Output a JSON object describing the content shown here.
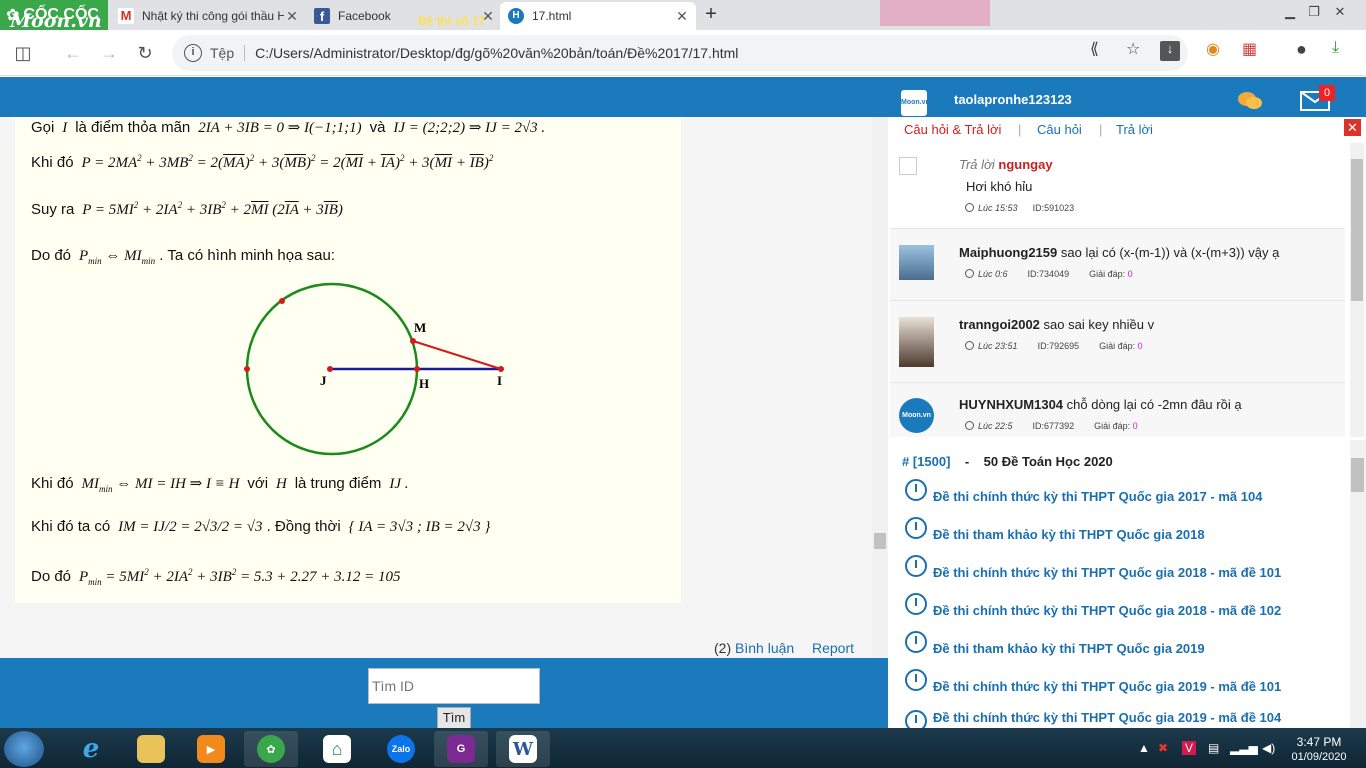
{
  "browser": {
    "brand": "CỐC CỐC",
    "tabs": [
      {
        "title": "Nhật ký thi công gói thầu Hồ",
        "active": false
      },
      {
        "title": "Facebook",
        "active": false
      },
      {
        "title": "17.html",
        "active": true
      }
    ],
    "new_tab": "+",
    "scheme_label": "Tệp",
    "url": "C:/Users/Administrator/Desktop/đg/gõ%20văn%20bản/toán/Đề%2017/17.html"
  },
  "site": {
    "logo": "Moon.vn",
    "exam_title": "Đề thi số 17"
  },
  "solution": {
    "l1_a": "Gọi",
    "l1_b": "là điểm thỏa mãn",
    "l1_c": "và",
    "l2_a": "Khi đó",
    "l3_a": "Suy ra",
    "l4_a": "Do đó",
    "l4_b": ". Ta có hình minh họa sau:",
    "fig_label_m": "M",
    "fig_label_j": "J",
    "fig_label_h": "H",
    "fig_label_i": "I",
    "l5_a": "Khi đó",
    "l5_b": "với",
    "l5_c": "là trung điểm",
    "l6_a": "Khi đó ta có",
    "l6_b": ". Đồng thời",
    "l7_a": "Do đó"
  },
  "comments": {
    "count": "(2)",
    "link": "Bình luận",
    "report": "Report"
  },
  "footer": {
    "search_placeholder": "Tìm ID",
    "search_button": "Tìm"
  },
  "panel": {
    "username": "taolapronhe123123",
    "mail_badge": "0",
    "tabs": [
      "Câu hỏi & Trả lời",
      "Câu hỏi",
      "Trả lời"
    ],
    "qa": [
      {
        "prefix": "Trả lời",
        "name": "ngungay",
        "text": "Hơi khó hỉu",
        "time": "Lúc 15:53",
        "id": "ID:591023",
        "answers": ""
      },
      {
        "prefix": "",
        "name": "Maiphuong2159",
        "text": "sao lại có (x-(m-1)) và (x-(m+3)) vậy ạ",
        "time": "Lúc 0:6",
        "id": "ID:734049",
        "answers_label": "Giải đáp:",
        "answers": "0"
      },
      {
        "prefix": "",
        "name": "tranngoi2002",
        "text": "sao sai key nhiều v",
        "time": "Lúc 23:51",
        "id": "ID:792695",
        "answers_label": "Giải đáp:",
        "answers": "0"
      },
      {
        "prefix": "",
        "name": "HUYNHXUM1304",
        "text": "chỗ dòng lại có -2mn đâu rồi ạ",
        "time": "Lúc 22:5",
        "id": "ID:677392",
        "answers_label": "Giải đáp:",
        "answers": "0"
      }
    ],
    "exam_series": {
      "id": "# [1500]",
      "sep": "-",
      "name": "50 Đề Toán Học 2020"
    },
    "exams": [
      "Đề thi chính thức kỳ thi THPT Quốc gia 2017 - mã 104",
      "Đề thi tham khảo kỳ thi THPT Quốc gia 2018",
      "Đề thi chính thức kỳ thi THPT Quốc gia 2018 - mã đề 101",
      "Đề thi chính thức kỳ thi THPT Quốc gia 2018 - mã đề 102",
      "Đề thi tham khảo kỳ thi THPT Quốc gia 2019",
      "Đề thi chính thức kỳ thi THPT Quốc gia 2019 - mã đề 101",
      "Đề thi chính thức kỳ thi THPT Quốc gia 2019 - mã đề 104"
    ]
  },
  "taskbar": {
    "time": "3:47 PM",
    "date": "01/09/2020",
    "apps": [
      "internet-explorer",
      "file-explorer",
      "media-player",
      "coc-coc",
      "app-green",
      "zalo",
      "pdf-reader",
      "word"
    ]
  }
}
